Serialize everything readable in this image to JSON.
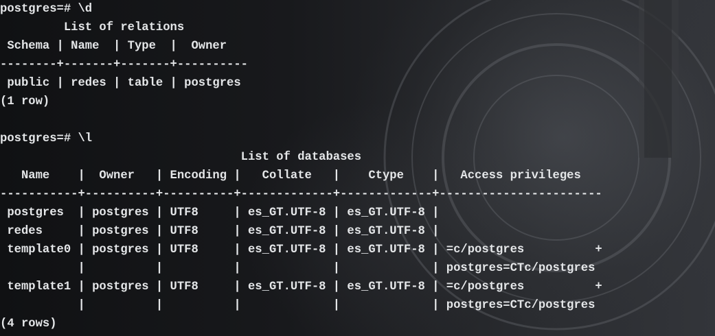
{
  "terminal": {
    "lines": [
      "postgres=# \\d",
      "         List of relations",
      " Schema | Name  | Type  |  Owner",
      "--------+-------+-------+----------",
      " public | redes | table | postgres",
      "(1 row)",
      "",
      "postgres=# \\l",
      "                                  List of databases",
      "   Name    |  Owner   | Encoding |   Collate   |    Ctype    |   Access privileges",
      "-----------+----------+----------+-------------+-------------+-----------------------",
      " postgres  | postgres | UTF8     | es_GT.UTF-8 | es_GT.UTF-8 |",
      " redes     | postgres | UTF8     | es_GT.UTF-8 | es_GT.UTF-8 |",
      " template0 | postgres | UTF8     | es_GT.UTF-8 | es_GT.UTF-8 | =c/postgres          +",
      "           |          |          |             |             | postgres=CTc/postgres",
      " template1 | postgres | UTF8     | es_GT.UTF-8 | es_GT.UTF-8 | =c/postgres          +",
      "           |          |          |             |             | postgres=CTc/postgres",
      "(4 rows)"
    ]
  }
}
